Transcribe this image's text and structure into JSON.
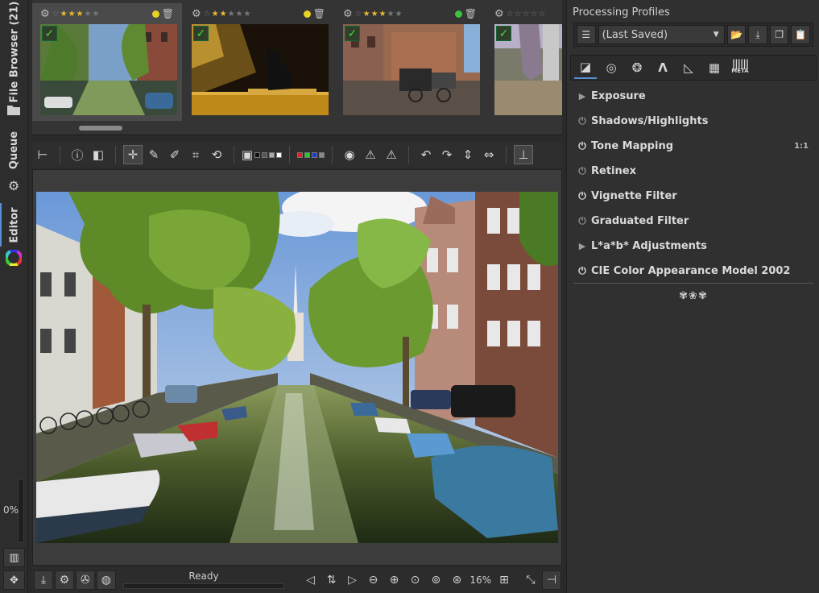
{
  "left_strip": {
    "file_browser_label": "File Browser (21)",
    "queue_label": "Queue",
    "editor_label": "Editor",
    "queue_progress_text": "0%"
  },
  "filmstrip": {
    "thumbnails": [
      {
        "rating": 3,
        "color_label": "#e8d225",
        "checked": true
      },
      {
        "rating": 2,
        "color_label": "#e8d225",
        "checked": true
      },
      {
        "rating": 3,
        "color_label": "#3fc13f",
        "checked": true
      },
      {
        "rating": 0,
        "color_label": "",
        "checked": true
      }
    ]
  },
  "bottom_bar": {
    "status_text": "Ready",
    "zoom_text": "16%"
  },
  "right_panel": {
    "profiles_title": "Processing Profiles",
    "profile_selected": "(Last Saved)",
    "meta_tab_label": "META",
    "tools": [
      {
        "label": "Exposure",
        "lead": "expander"
      },
      {
        "label": "Shadows/Highlights",
        "lead": "power-off"
      },
      {
        "label": "Tone Mapping",
        "lead": "power-on",
        "right": "1:1"
      },
      {
        "label": "Retinex",
        "lead": "power-off"
      },
      {
        "label": "Vignette Filter",
        "lead": "power-on"
      },
      {
        "label": "Graduated Filter",
        "lead": "power-off"
      },
      {
        "label": "L*a*b* Adjustments",
        "lead": "expander"
      },
      {
        "label": "CIE Color Appearance Model 2002",
        "lead": "power-on"
      }
    ]
  },
  "colors": {
    "accent": "#5a8fd6",
    "check_green": "#45d83e",
    "star_gold": "#e7b830"
  }
}
